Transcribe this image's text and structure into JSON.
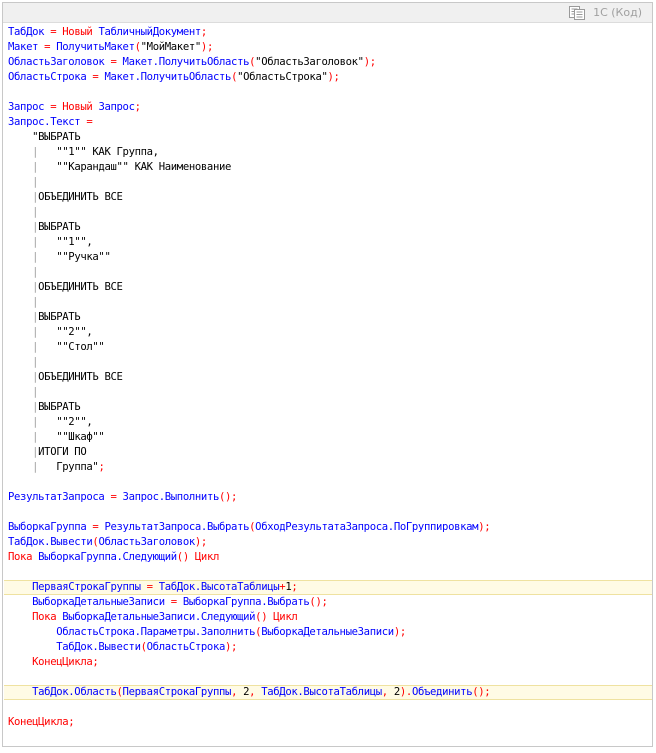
{
  "header": {
    "label": "1С (Код)",
    "copy_icon": "copy-icon"
  },
  "colors": {
    "identifier": "#0000ff",
    "keyword": "#ff0000",
    "string": "#000000",
    "guide": "#a0a0a0",
    "highlight_bg": "#fffbe5"
  },
  "lines": [
    {
      "hl": false,
      "segs": [
        [
          "blue",
          "ТабДок "
        ],
        [
          "red",
          "= "
        ],
        [
          "red",
          "Новый "
        ],
        [
          "blue",
          "ТабличныйДокумент"
        ],
        [
          "red",
          ";"
        ]
      ]
    },
    {
      "hl": false,
      "segs": [
        [
          "blue",
          "Макет "
        ],
        [
          "red",
          "= "
        ],
        [
          "blue",
          "ПолучитьМакет"
        ],
        [
          "red",
          "("
        ],
        [
          "black",
          "\"МойМакет\""
        ],
        [
          "red",
          ");"
        ]
      ]
    },
    {
      "hl": false,
      "segs": [
        [
          "blue",
          "ОбластьЗаголовок "
        ],
        [
          "red",
          "= "
        ],
        [
          "blue",
          "Макет.ПолучитьОбласть"
        ],
        [
          "red",
          "("
        ],
        [
          "black",
          "\"ОбластьЗаголовок\""
        ],
        [
          "red",
          ");"
        ]
      ]
    },
    {
      "hl": false,
      "segs": [
        [
          "blue",
          "ОбластьСтрока "
        ],
        [
          "red",
          "= "
        ],
        [
          "blue",
          "Макет.ПолучитьОбласть"
        ],
        [
          "red",
          "("
        ],
        [
          "black",
          "\"ОбластьСтрока\""
        ],
        [
          "red",
          ");"
        ]
      ]
    },
    {
      "hl": false,
      "segs": []
    },
    {
      "hl": false,
      "segs": [
        [
          "blue",
          "Запрос "
        ],
        [
          "red",
          "= "
        ],
        [
          "red",
          "Новый "
        ],
        [
          "blue",
          "Запрос"
        ],
        [
          "red",
          ";"
        ]
      ]
    },
    {
      "hl": false,
      "segs": [
        [
          "blue",
          "Запрос.Текст "
        ],
        [
          "red",
          "="
        ]
      ]
    },
    {
      "hl": false,
      "segs": [
        [
          "black",
          "    \"ВЫБРАТЬ"
        ]
      ]
    },
    {
      "hl": false,
      "segs": [
        [
          "gray",
          "    |   "
        ],
        [
          "black",
          "\"\"1\"\" КАК Группа,"
        ]
      ]
    },
    {
      "hl": false,
      "segs": [
        [
          "gray",
          "    |   "
        ],
        [
          "black",
          "\"\"Карандаш\"\" КАК Наименование"
        ]
      ]
    },
    {
      "hl": false,
      "segs": [
        [
          "gray",
          "    |"
        ]
      ]
    },
    {
      "hl": false,
      "segs": [
        [
          "gray",
          "    |"
        ],
        [
          "black",
          "ОБЪЕДИНИТЬ ВСЕ"
        ]
      ]
    },
    {
      "hl": false,
      "segs": [
        [
          "gray",
          "    |"
        ]
      ]
    },
    {
      "hl": false,
      "segs": [
        [
          "gray",
          "    |"
        ],
        [
          "black",
          "ВЫБРАТЬ"
        ]
      ]
    },
    {
      "hl": false,
      "segs": [
        [
          "gray",
          "    |   "
        ],
        [
          "black",
          "\"\"1\"\","
        ]
      ]
    },
    {
      "hl": false,
      "segs": [
        [
          "gray",
          "    |   "
        ],
        [
          "black",
          "\"\"Ручка\"\""
        ]
      ]
    },
    {
      "hl": false,
      "segs": [
        [
          "gray",
          "    |"
        ]
      ]
    },
    {
      "hl": false,
      "segs": [
        [
          "gray",
          "    |"
        ],
        [
          "black",
          "ОБЪЕДИНИТЬ ВСЕ"
        ]
      ]
    },
    {
      "hl": false,
      "segs": [
        [
          "gray",
          "    |"
        ]
      ]
    },
    {
      "hl": false,
      "segs": [
        [
          "gray",
          "    |"
        ],
        [
          "black",
          "ВЫБРАТЬ"
        ]
      ]
    },
    {
      "hl": false,
      "segs": [
        [
          "gray",
          "    |   "
        ],
        [
          "black",
          "\"\"2\"\","
        ]
      ]
    },
    {
      "hl": false,
      "segs": [
        [
          "gray",
          "    |   "
        ],
        [
          "black",
          "\"\"Стол\"\""
        ]
      ]
    },
    {
      "hl": false,
      "segs": [
        [
          "gray",
          "    |"
        ]
      ]
    },
    {
      "hl": false,
      "segs": [
        [
          "gray",
          "    |"
        ],
        [
          "black",
          "ОБЪЕДИНИТЬ ВСЕ"
        ]
      ]
    },
    {
      "hl": false,
      "segs": [
        [
          "gray",
          "    |"
        ]
      ]
    },
    {
      "hl": false,
      "segs": [
        [
          "gray",
          "    |"
        ],
        [
          "black",
          "ВЫБРАТЬ"
        ]
      ]
    },
    {
      "hl": false,
      "segs": [
        [
          "gray",
          "    |   "
        ],
        [
          "black",
          "\"\"2\"\","
        ]
      ]
    },
    {
      "hl": false,
      "segs": [
        [
          "gray",
          "    |   "
        ],
        [
          "black",
          "\"\"Шкаф\"\""
        ]
      ]
    },
    {
      "hl": false,
      "segs": [
        [
          "gray",
          "    |"
        ],
        [
          "black",
          "ИТОГИ ПО"
        ]
      ]
    },
    {
      "hl": false,
      "segs": [
        [
          "gray",
          "    |   "
        ],
        [
          "black",
          "Группа\""
        ],
        [
          "red",
          ";"
        ]
      ]
    },
    {
      "hl": false,
      "segs": []
    },
    {
      "hl": false,
      "segs": [
        [
          "blue",
          "РезультатЗапроса "
        ],
        [
          "red",
          "= "
        ],
        [
          "blue",
          "Запрос.Выполнить"
        ],
        [
          "red",
          "();"
        ]
      ]
    },
    {
      "hl": false,
      "segs": []
    },
    {
      "hl": false,
      "segs": [
        [
          "blue",
          "ВыборкаГруппа "
        ],
        [
          "red",
          "= "
        ],
        [
          "blue",
          "РезультатЗапроса.Выбрать"
        ],
        [
          "red",
          "("
        ],
        [
          "blue",
          "ОбходРезультатаЗапроса.ПоГруппировкам"
        ],
        [
          "red",
          ");"
        ]
      ]
    },
    {
      "hl": false,
      "segs": [
        [
          "blue",
          "ТабДок.Вывести"
        ],
        [
          "red",
          "("
        ],
        [
          "blue",
          "ОбластьЗаголовок"
        ],
        [
          "red",
          ");"
        ]
      ]
    },
    {
      "hl": false,
      "segs": [
        [
          "red",
          "Пока "
        ],
        [
          "blue",
          "ВыборкаГруппа.Следующий"
        ],
        [
          "red",
          "() "
        ],
        [
          "red",
          "Цикл"
        ]
      ]
    },
    {
      "hl": false,
      "segs": []
    },
    {
      "hl": true,
      "segs": [
        [
          "blue",
          "    ПерваяСтрокаГруппы "
        ],
        [
          "red",
          "= "
        ],
        [
          "blue",
          "ТабДок.ВысотаТаблицы"
        ],
        [
          "red",
          "+"
        ],
        [
          "black",
          "1"
        ],
        [
          "red",
          ";"
        ]
      ]
    },
    {
      "hl": false,
      "segs": [
        [
          "blue",
          "    ВыборкаДетальныеЗаписи "
        ],
        [
          "red",
          "= "
        ],
        [
          "blue",
          "ВыборкаГруппа.Выбрать"
        ],
        [
          "red",
          "();"
        ]
      ]
    },
    {
      "hl": false,
      "segs": [
        [
          "red",
          "    Пока "
        ],
        [
          "blue",
          "ВыборкаДетальныеЗаписи.Следующий"
        ],
        [
          "red",
          "() "
        ],
        [
          "red",
          "Цикл"
        ]
      ]
    },
    {
      "hl": false,
      "segs": [
        [
          "blue",
          "        ОбластьСтрока.Параметры.Заполнить"
        ],
        [
          "red",
          "("
        ],
        [
          "blue",
          "ВыборкаДетальныеЗаписи"
        ],
        [
          "red",
          ");"
        ]
      ]
    },
    {
      "hl": false,
      "segs": [
        [
          "blue",
          "        ТабДок.Вывести"
        ],
        [
          "red",
          "("
        ],
        [
          "blue",
          "ОбластьСтрока"
        ],
        [
          "red",
          ");"
        ]
      ]
    },
    {
      "hl": false,
      "segs": [
        [
          "red",
          "    КонецЦикла;"
        ]
      ]
    },
    {
      "hl": false,
      "segs": []
    },
    {
      "hl": true,
      "segs": [
        [
          "blue",
          "    ТабДок.Область"
        ],
        [
          "red",
          "("
        ],
        [
          "blue",
          "ПерваяСтрокаГруппы"
        ],
        [
          "red",
          ", "
        ],
        [
          "black",
          "2"
        ],
        [
          "red",
          ", "
        ],
        [
          "blue",
          "ТабДок.ВысотаТаблицы"
        ],
        [
          "red",
          ", "
        ],
        [
          "black",
          "2"
        ],
        [
          "red",
          ")."
        ],
        [
          "blue",
          "Объединить"
        ],
        [
          "red",
          "();"
        ]
      ]
    },
    {
      "hl": false,
      "segs": []
    },
    {
      "hl": false,
      "segs": [
        [
          "red",
          "КонецЦикла;"
        ]
      ]
    }
  ]
}
